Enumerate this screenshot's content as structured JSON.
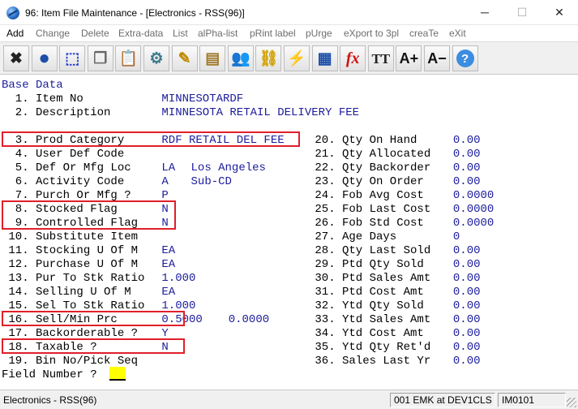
{
  "window": {
    "title": "96: Item File Maintenance - [Electronics - RSS(96)]",
    "minimize_glyph": "─",
    "maximize_glyph": "☐",
    "close_glyph": "✕"
  },
  "menu": {
    "items": [
      "Add",
      "Change",
      "Delete",
      "Extra-data",
      "List",
      "alPha-list",
      "pRint label",
      "pUrge",
      "eXport to 3pl",
      "creaTe",
      "eXit"
    ]
  },
  "toolbar": {
    "buttons": [
      {
        "icon": "close-x-icon",
        "glyph": "✖",
        "color": "#222222"
      },
      {
        "icon": "globe-icon",
        "glyph": "●",
        "color": "#1d4fa8"
      },
      {
        "icon": "select-box-icon",
        "glyph": "⬚",
        "color": "#2a3fd0"
      },
      {
        "icon": "copy-icon",
        "glyph": "❐",
        "color": "#666666"
      },
      {
        "icon": "paste-icon",
        "glyph": "📋",
        "color": "#666666"
      },
      {
        "icon": "settings-gear-icon",
        "glyph": "⚙",
        "color": "#3a7a8c"
      },
      {
        "icon": "edit-pencil-icon",
        "glyph": "✎",
        "color": "#c08a00"
      },
      {
        "icon": "notepad-icon",
        "glyph": "▤",
        "color": "#a07a2a"
      },
      {
        "icon": "users-icon",
        "glyph": "👥",
        "color": "#2a7a2a"
      },
      {
        "icon": "link-chain-icon",
        "glyph": "⛓",
        "color": "#d0a000"
      },
      {
        "icon": "lightning-icon",
        "glyph": "⚡",
        "color": "#d01010"
      },
      {
        "icon": "calendar-icon",
        "glyph": "▦",
        "color": "#1d4fa8"
      },
      {
        "icon": "function-fx-icon",
        "glyph": "fx",
        "color": "#d01010"
      },
      {
        "icon": "text-style-icon",
        "glyph": "TT",
        "color": "#222222"
      },
      {
        "icon": "font-increase-icon",
        "glyph": "A+",
        "color": "#111111"
      },
      {
        "icon": "font-decrease-icon",
        "glyph": "A−",
        "color": "#111111"
      },
      {
        "icon": "help-icon",
        "glyph": "?",
        "color": "#ffffff"
      }
    ]
  },
  "section_title": "Base Data",
  "fields_top": [
    {
      "label": "  1. Item No",
      "value": "MINNESOTARDF",
      "extra": ""
    },
    {
      "label": "  2. Description",
      "value": "MINNESOTA RETAIL DELIVERY FEE",
      "extra": ""
    }
  ],
  "fields_left": [
    {
      "label": "  3. Prod Category",
      "value": "RDF RETAIL DEL FEE",
      "extra": ""
    },
    {
      "label": "  4. User Def Code",
      "value": "",
      "extra": ""
    },
    {
      "label": "  5. Def Or Mfg Loc",
      "value": "LA",
      "extra": "Los Angeles"
    },
    {
      "label": "  6. Activity Code",
      "value": "A",
      "extra": "Sub-CD"
    },
    {
      "label": "  7. Purch Or Mfg ?",
      "value": "P",
      "extra": ""
    },
    {
      "label": "  8. Stocked Flag",
      "value": "N",
      "extra": ""
    },
    {
      "label": "  9. Controlled Flag",
      "value": "N",
      "extra": ""
    },
    {
      "label": " 10. Substitute Item",
      "value": "",
      "extra": ""
    },
    {
      "label": " 11. Stocking U Of M",
      "value": "EA",
      "extra": ""
    },
    {
      "label": " 12. Purchase U Of M",
      "value": "EA",
      "extra": ""
    },
    {
      "label": " 13. Pur To Stk Ratio",
      "value": "1.000",
      "extra": ""
    },
    {
      "label": " 14. Selling U Of M",
      "value": "EA",
      "extra": ""
    },
    {
      "label": " 15. Sel To Stk Ratio",
      "value": "1.000",
      "extra": ""
    },
    {
      "label": " 16. Sell/Min Prc",
      "value": "0.5000",
      "extra": "0.0000"
    },
    {
      "label": " 17. Backorderable ?",
      "value": "Y",
      "extra": ""
    },
    {
      "label": " 18. Taxable ?",
      "value": "N",
      "extra": ""
    },
    {
      "label": " 19. Bin No/Pick Seq",
      "value": "",
      "extra": ""
    }
  ],
  "fields_right": [
    {
      "label": "20. Qty On Hand",
      "value": "0.00"
    },
    {
      "label": "21. Qty Allocated",
      "value": "0.00"
    },
    {
      "label": "22. Qty Backorder",
      "value": "0.00"
    },
    {
      "label": "23. Qty On Order",
      "value": "0.00"
    },
    {
      "label": "24. Fob Avg Cost",
      "value": "0.0000"
    },
    {
      "label": "25. Fob Last Cost",
      "value": "0.0000"
    },
    {
      "label": "26. Fob Std Cost",
      "value": "0.0000"
    },
    {
      "label": "27. Age Days",
      "value": "0"
    },
    {
      "label": "28. Qty Last Sold",
      "value": "0.00"
    },
    {
      "label": "29. Ptd Qty Sold",
      "value": "0.00"
    },
    {
      "label": "30. Ptd Sales Amt",
      "value": "0.00"
    },
    {
      "label": "31. Ptd Cost Amt",
      "value": "0.00"
    },
    {
      "label": "32. Ytd Qty Sold",
      "value": "0.00"
    },
    {
      "label": "33. Ytd Sales Amt",
      "value": "0.00"
    },
    {
      "label": "34. Ytd Cost Amt",
      "value": "0.00"
    },
    {
      "label": "35. Ytd Qty Ret'd",
      "value": "0.00"
    },
    {
      "label": "36. Sales Last Yr",
      "value": "0.00"
    }
  ],
  "prompt": {
    "text": "Field Number ?"
  },
  "statusbar": {
    "left": "Electronics - RSS(96)",
    "user": "001 EMK at DEV1CLS",
    "screen": "IM0101"
  },
  "highlight_color": "#e0202a"
}
